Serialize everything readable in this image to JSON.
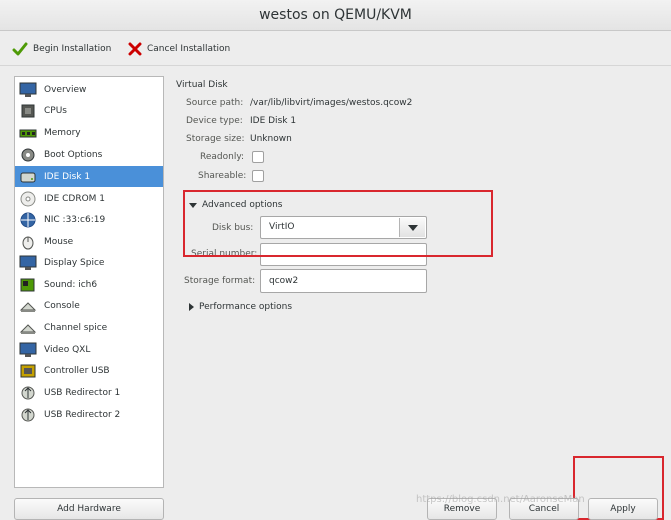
{
  "window": {
    "title": "westos on QEMU/KVM"
  },
  "toolbar": {
    "begin_label": "Begin Installation",
    "cancel_label": "Cancel Installation"
  },
  "sidebar": {
    "items": [
      {
        "label": "Overview",
        "icon": "monitor-icon"
      },
      {
        "label": "CPUs",
        "icon": "cpu-icon"
      },
      {
        "label": "Memory",
        "icon": "memory-icon"
      },
      {
        "label": "Boot Options",
        "icon": "gear-icon"
      },
      {
        "label": "IDE Disk 1",
        "icon": "disk-icon"
      },
      {
        "label": "IDE CDROM 1",
        "icon": "cdrom-icon"
      },
      {
        "label": "NIC :33:c6:19",
        "icon": "network-icon"
      },
      {
        "label": "Mouse",
        "icon": "mouse-icon"
      },
      {
        "label": "Display Spice",
        "icon": "display-icon"
      },
      {
        "label": "Sound: ich6",
        "icon": "sound-icon"
      },
      {
        "label": "Console",
        "icon": "console-icon"
      },
      {
        "label": "Channel spice",
        "icon": "channel-icon"
      },
      {
        "label": "Video QXL",
        "icon": "video-icon"
      },
      {
        "label": "Controller USB",
        "icon": "controller-icon"
      },
      {
        "label": "USB Redirector 1",
        "icon": "usb-icon"
      },
      {
        "label": "USB Redirector 2",
        "icon": "usb-icon"
      }
    ],
    "selected": "IDE Disk 1",
    "add_hardware_label": "Add Hardware"
  },
  "details": {
    "section_title": "Virtual Disk",
    "source_path_label": "Source path:",
    "source_path_value": "/var/lib/libvirt/images/westos.qcow2",
    "device_type_label": "Device type:",
    "device_type_value": "IDE Disk 1",
    "storage_size_label": "Storage size:",
    "storage_size_value": "Unknown",
    "readonly_label": "Readonly:",
    "shareable_label": "Shareable:",
    "advanced_label": "Advanced options",
    "disk_bus_label": "Disk bus:",
    "disk_bus_value": "VirtIO",
    "serial_label": "Serial number:",
    "serial_value": "",
    "storage_format_label": "Storage format:",
    "storage_format_value": "qcow2",
    "performance_label": "Performance options"
  },
  "buttons": {
    "remove_label": "Remove",
    "cancel_label": "Cancel",
    "apply_label": "Apply"
  },
  "watermark": "https://blog.csdn.net/AaronseMan",
  "colors": {
    "selection": "#4a90d9",
    "highlight_box": "#d9272e"
  }
}
